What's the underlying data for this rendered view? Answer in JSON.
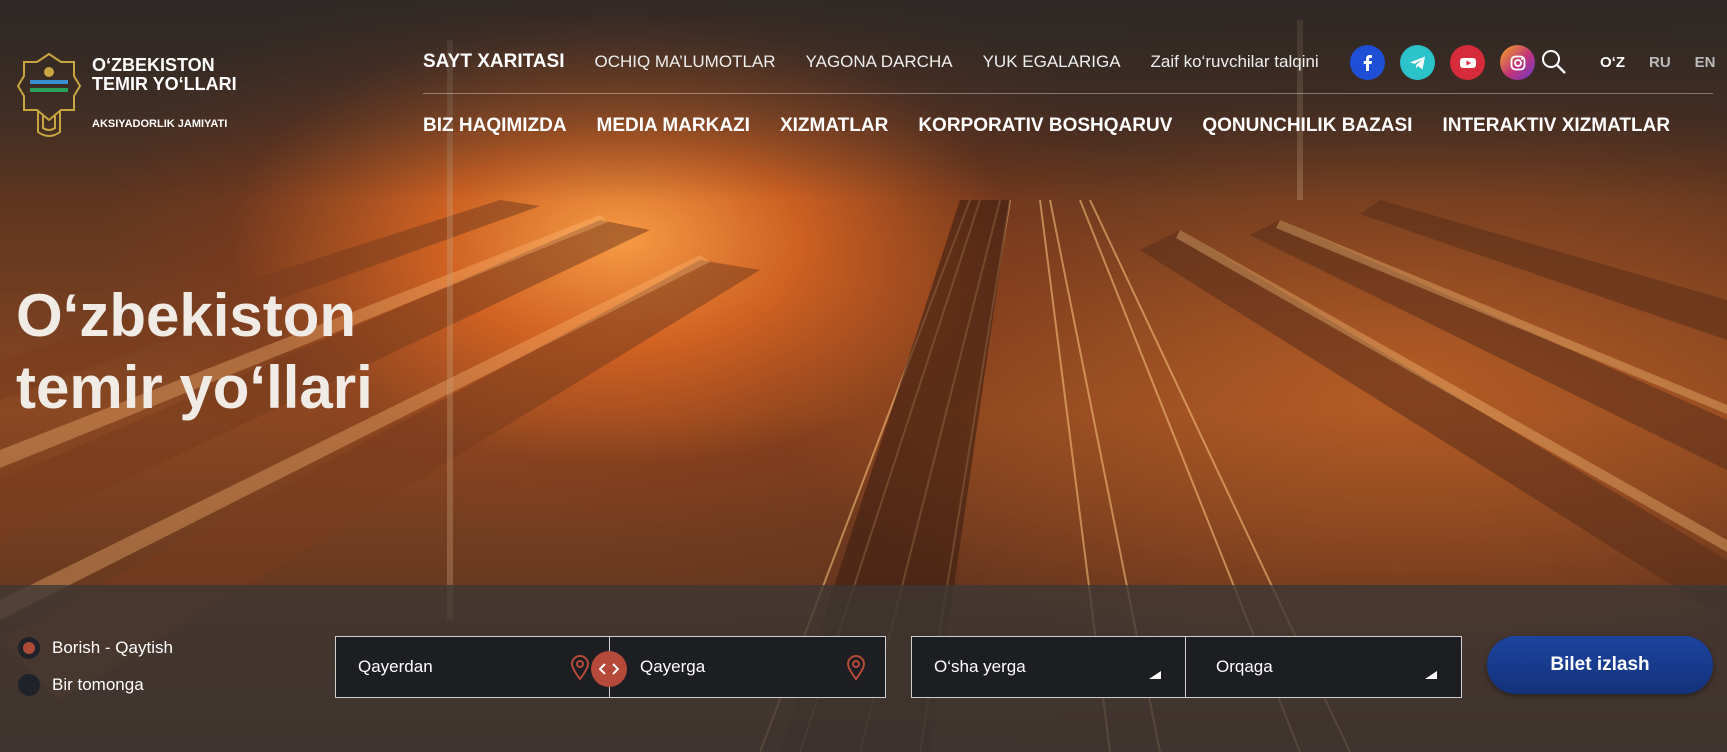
{
  "brand": {
    "title_line1": "O‘ZBEKISTON",
    "title_line2": "TEMIR YO‘LLARI",
    "subtitle": "AKSIYADORLIK JAMIYATI"
  },
  "top_nav": [
    {
      "label": "SAYT XARITASI"
    },
    {
      "label": "OCHIQ MA’LUMOTLAR"
    },
    {
      "label": "YAGONA DARCHA"
    },
    {
      "label": "YUK EGALARIGA"
    },
    {
      "label": "Zaif ko‘ruvchilar talqini"
    }
  ],
  "socials": [
    {
      "icon": "facebook-icon",
      "color": "#1e4fd6"
    },
    {
      "icon": "telegram-icon",
      "color": "#2bc2c9"
    },
    {
      "icon": "youtube-icon",
      "color": "#d62b3a"
    },
    {
      "icon": "instagram-icon",
      "color": "#c0337a"
    }
  ],
  "languages": [
    {
      "label": "O‘Z",
      "active": true
    },
    {
      "label": "RU",
      "active": false
    },
    {
      "label": "EN",
      "active": false
    }
  ],
  "main_nav": [
    {
      "label": "BIZ HAQIMIZDA"
    },
    {
      "label": "MEDIA MARKAZI"
    },
    {
      "label": "XIZMATLAR"
    },
    {
      "label": "KORPORATIV BOSHQARUV"
    },
    {
      "label": "QONUNCHILIK BAZASI"
    },
    {
      "label": "INTERAKTIV XIZMATLAR"
    }
  ],
  "hero": {
    "title_line1": "O‘zbekiston",
    "title_line2": "temir yo‘llari"
  },
  "booking": {
    "trip_types": [
      {
        "label": "Borish - Qaytish",
        "selected": true
      },
      {
        "label": "Bir tomonga",
        "selected": false
      }
    ],
    "from_placeholder": "Qayerdan",
    "to_placeholder": "Qayerga",
    "departure_value": "O‘sha yerga",
    "return_value": "Orqaga",
    "search_label": "Bilet izlash"
  },
  "colors": {
    "accent_red": "#b5493a",
    "button_blue": "#1c44a0"
  }
}
